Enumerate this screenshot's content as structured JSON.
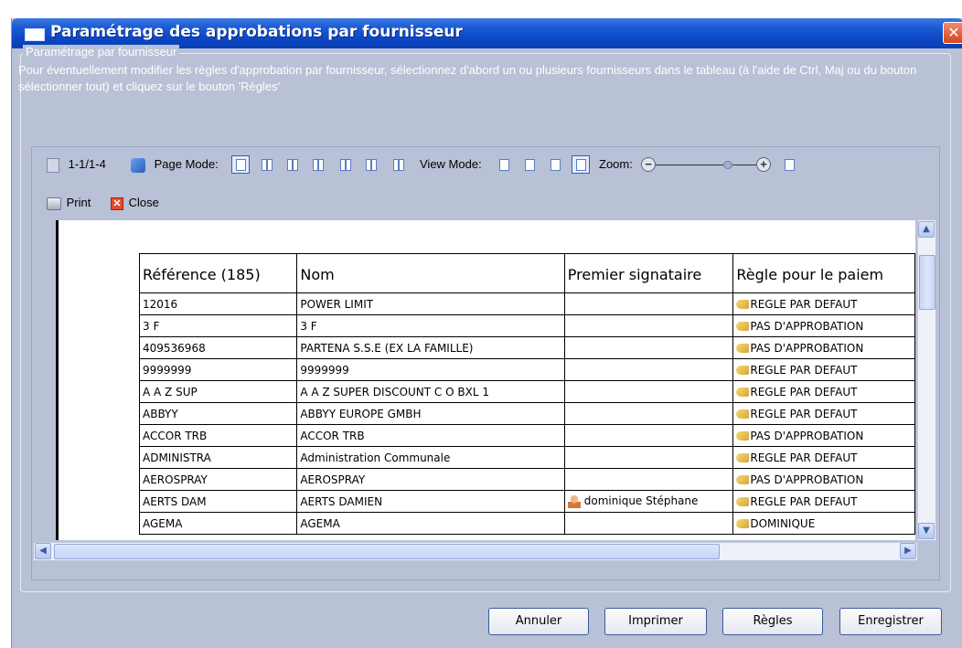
{
  "window": {
    "title": "Paramétrage des approbations par fournisseur",
    "close_glyph": "✕"
  },
  "group": {
    "legend": "Paramétrage par fournisseur",
    "description": "Pour éventuellement modifier les règles d'approbation par fournisseur, sélectionnez d'abord un ou plusieurs fournisseurs dans le tableau (à l'aide de Ctrl, Maj ou du bouton sélectionner tout) et cliquez sur le bouton 'Règles'"
  },
  "viewer_toolbar": {
    "page_counter": "1-1/1-4",
    "page_mode_label": "Page Mode:",
    "view_mode_label": "View Mode:",
    "zoom_label": "Zoom:",
    "zoom_minus": "−",
    "zoom_plus": "+",
    "print_label": "Print",
    "close_label": "Close",
    "zoom_level": 0.72
  },
  "table": {
    "headers": [
      "Référence (185)",
      "Nom",
      "Premier signataire",
      "Règle pour le paiem"
    ],
    "rows": [
      [
        "12016",
        "POWER LIMIT",
        "",
        "REGLE PAR DEFAUT"
      ],
      [
        "3 F",
        "3 F",
        "",
        "PAS D'APPROBATION"
      ],
      [
        "409536968",
        "PARTENA S.S.E (EX LA FAMILLE)",
        "",
        "PAS D'APPROBATION"
      ],
      [
        "9999999",
        "9999999",
        "",
        "REGLE PAR DEFAUT"
      ],
      [
        "A A Z SUP",
        "A A Z SUPER DISCOUNT C O BXL 1",
        "",
        "REGLE PAR DEFAUT"
      ],
      [
        "ABBYY",
        "ABBYY EUROPE GMBH",
        "",
        "REGLE PAR DEFAUT"
      ],
      [
        "ACCOR TRB",
        "ACCOR TRB",
        "",
        "PAS D'APPROBATION"
      ],
      [
        "ADMINISTRA",
        "Administration Communale",
        "",
        "REGLE PAR DEFAUT"
      ],
      [
        "AEROSPRAY",
        "AEROSPRAY",
        "",
        "PAS D'APPROBATION"
      ],
      [
        "AERTS DAM",
        "AERTS DAMIEN",
        "dominique Stéphane",
        "REGLE PAR DEFAUT"
      ],
      [
        "AGEMA",
        "AGEMA",
        "",
        "DOMINIQUE"
      ]
    ]
  },
  "buttons": {
    "cancel": "Annuler",
    "print": "Imprimer",
    "rules": "Règles",
    "save": "Enregistrer"
  },
  "colors": {
    "titlebar": "#0b46c4",
    "dialog_bg": "#b9c1d6",
    "button_border": "#3a5a9c"
  }
}
